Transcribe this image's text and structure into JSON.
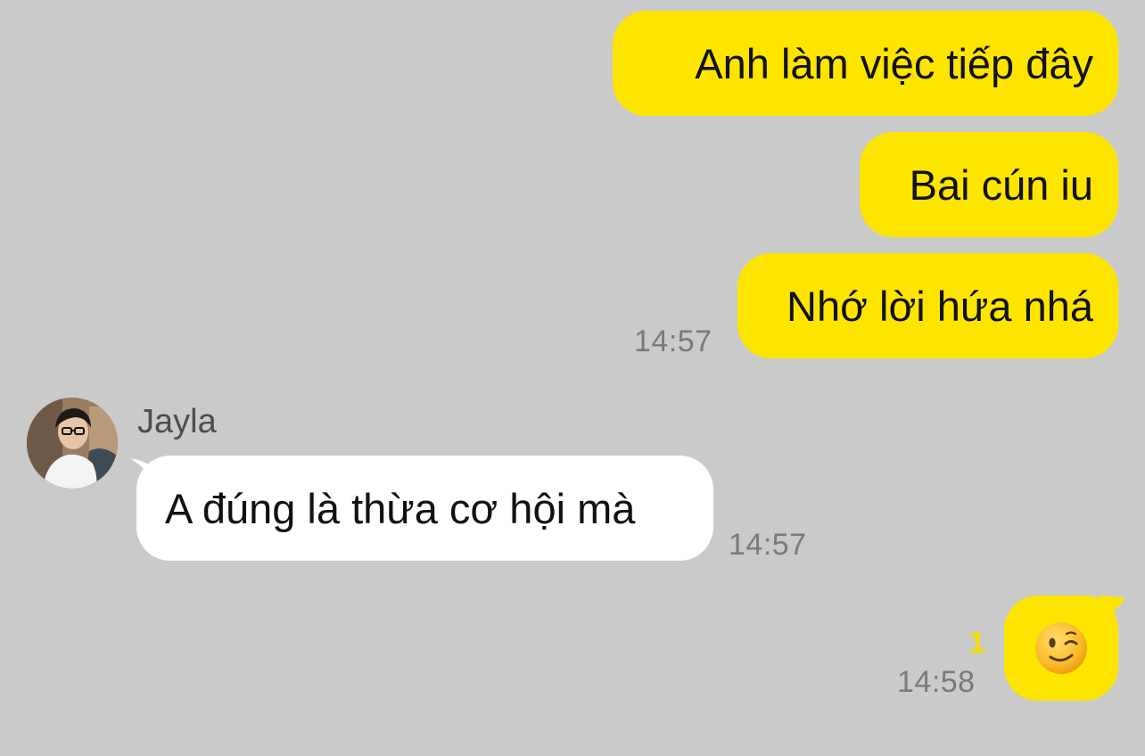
{
  "messages": {
    "m1": {
      "text": "Anh làm việc tiếp đây"
    },
    "m2": {
      "text": "Bai cún iu"
    },
    "m3": {
      "text": "Nhớ lời hứa nhá",
      "time": "14:57"
    },
    "m4": {
      "sender": "Jayla",
      "text": "A đúng là thừa cơ hội mà",
      "time": "14:57"
    },
    "m5": {
      "emoji": "winking-face",
      "unread_count": "1",
      "time": "14:58"
    }
  },
  "colors": {
    "background": "#cacaca",
    "my_bubble": "#fde500",
    "their_bubble": "#ffffff",
    "timestamp": "#7a7a7a",
    "unread": "#f7dd00"
  }
}
